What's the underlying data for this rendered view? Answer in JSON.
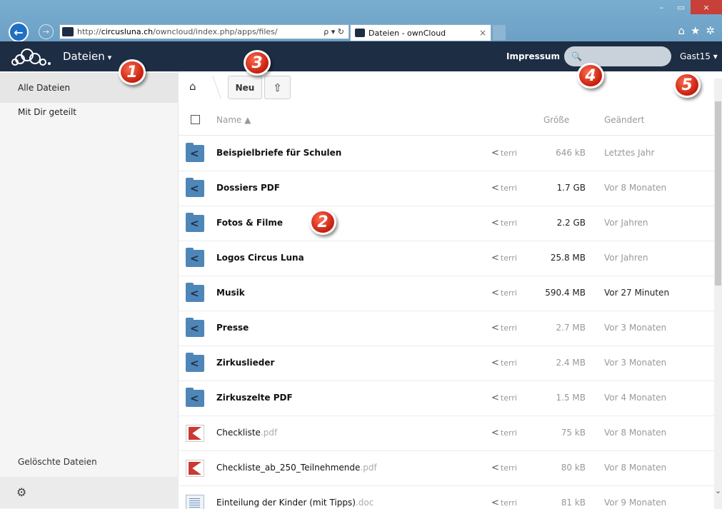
{
  "browser": {
    "url_prefix": "http://",
    "url_host": "circusluna.ch",
    "url_path": "/owncloud/index.php/apps/files/",
    "address_tools": "ρ ▾ ↻",
    "tab_title": "Dateien - ownCloud",
    "tab_close": "×",
    "min_label": "–",
    "max_label": "▭",
    "close_label": "×",
    "back_label": "←",
    "forward_label": "→",
    "home_glyph": "⌂",
    "star_glyph": "★",
    "gear_glyph": "✲"
  },
  "header": {
    "app_name": "Dateien",
    "caret": "▾",
    "impressum": "Impressum",
    "search_placeholder": "",
    "search_glyph": "🔍",
    "user": "Gast15 ▾"
  },
  "sidebar": {
    "items": [
      {
        "label": "Alle Dateien",
        "active": true
      },
      {
        "label": "Mit Dir geteilt",
        "active": false
      }
    ],
    "trash_label": "Gelöschte Dateien",
    "settings_glyph": "⚙"
  },
  "toolbar": {
    "home_glyph": "⌂",
    "new_label": "Neu",
    "upload_glyph": "⇧"
  },
  "list": {
    "columns": {
      "name": "Name ▲",
      "size": "Größe",
      "modified": "Geändert"
    },
    "share_glyph": "<",
    "rows": [
      {
        "type": "folder",
        "name": "Beispielbriefe für Schulen",
        "ext": "",
        "share": "terri",
        "size": "646 kB",
        "modified": "Letztes Jahr",
        "size_color": "#999999",
        "mod_color": "#999999"
      },
      {
        "type": "folder",
        "name": "Dossiers PDF",
        "ext": "",
        "share": "terri",
        "size": "1.7 GB",
        "modified": "Vor 8 Monaten",
        "size_color": "#222222",
        "mod_color": "#999999"
      },
      {
        "type": "folder",
        "name": "Fotos & Filme",
        "ext": "",
        "share": "terri",
        "size": "2.2 GB",
        "modified": "Vor Jahren",
        "size_color": "#222222",
        "mod_color": "#999999"
      },
      {
        "type": "folder",
        "name": "Logos Circus Luna",
        "ext": "",
        "share": "terri",
        "size": "25.8 MB",
        "modified": "Vor Jahren",
        "size_color": "#222222",
        "mod_color": "#999999"
      },
      {
        "type": "folder",
        "name": "Musik",
        "ext": "",
        "share": "terri",
        "size": "590.4 MB",
        "modified": "Vor 27 Minuten",
        "size_color": "#222222",
        "mod_color": "#222222"
      },
      {
        "type": "folder",
        "name": "Presse",
        "ext": "",
        "share": "terri",
        "size": "2.7 MB",
        "modified": "Vor 3 Monaten",
        "size_color": "#999999",
        "mod_color": "#999999"
      },
      {
        "type": "folder",
        "name": "Zirkuslieder",
        "ext": "",
        "share": "terri",
        "size": "2.4 MB",
        "modified": "Vor 3 Monaten",
        "size_color": "#999999",
        "mod_color": "#999999"
      },
      {
        "type": "folder",
        "name": "Zirkuszelte PDF",
        "ext": "",
        "share": "terri",
        "size": "1.5 MB",
        "modified": "Vor 4 Monaten",
        "size_color": "#999999",
        "mod_color": "#999999"
      },
      {
        "type": "pdf",
        "name": "Checkliste",
        "ext": ".pdf",
        "share": "terri",
        "size": "75 kB",
        "modified": "Vor 8 Monaten",
        "size_color": "#999999",
        "mod_color": "#999999"
      },
      {
        "type": "pdf",
        "name": "Checkliste_ab_250_Teilnehmende",
        "ext": ".pdf",
        "share": "terri",
        "size": "80 kB",
        "modified": "Vor 8 Monaten",
        "size_color": "#999999",
        "mod_color": "#999999"
      },
      {
        "type": "doc",
        "name": "Einteilung der Kinder (mit Tipps)",
        "ext": ".doc",
        "share": "terri",
        "size": "81 kB",
        "modified": "Vor 9 Monaten",
        "size_color": "#999999",
        "mod_color": "#999999"
      }
    ]
  },
  "badges": [
    "1",
    "2",
    "3",
    "4",
    "5"
  ],
  "colors": {
    "header_bg": "#1d2d44",
    "folder": "#4f86b8",
    "badge": "#d9301a"
  }
}
